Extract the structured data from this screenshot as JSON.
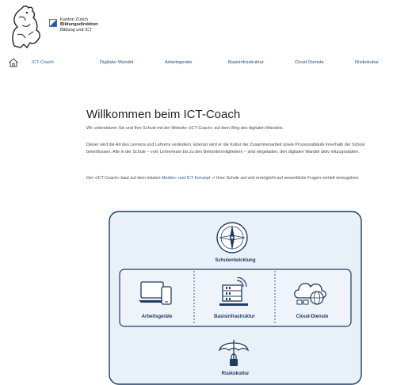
{
  "header": {
    "org_lines": [
      "Kanton Zürich",
      "Bildungsdirektion",
      "Bildung und ICT"
    ]
  },
  "nav": {
    "items": [
      {
        "label": "ICT-Coach",
        "active": true
      },
      {
        "label": "Digitaler Wandel"
      },
      {
        "label": "Arbeitsgeräte"
      },
      {
        "label": "Basisinfrastruktur"
      },
      {
        "label": "Cloud-Dienste"
      },
      {
        "label": "Risikokultur"
      }
    ]
  },
  "main": {
    "title": "Willkommen beim ICT-Coach",
    "p1": "Wir unterstützen Sie und Ihre Schule mit der Website «ICT-Coach» auf dem Weg des digitalen Wandels.",
    "p2": "Dieser wird die Art des Lernens und Lehrens verändern. Ebenso wird er die Kultur der Zusammenarbeit sowie Prozessabläufe innerhalb der Schule beeinflussen. Alle in der Schule – vom Lehrerteam bis zu den Behördenmitgliedern – sind eingeladen, den digitalen Wandel aktiv mitzugestalten.",
    "p3_before": "Der «ICT-Coach» baut auf dem lokalen ",
    "p3_link": "Medien- und ICT-Konzept ↗",
    "p3_after": " Ihrer Schule auf und ermöglicht auf wesentliche Fragen vertieft einzugehen."
  },
  "diagram": {
    "top": "Schulentwicklung",
    "middle": [
      "Arbeitsgeräte",
      "Basisinfrastruktur",
      "Cloud-Dienste"
    ],
    "bottom": "Risikokultur"
  },
  "colors": {
    "accent": "#1f5fa8",
    "diagram_fill": "#e9f1f8",
    "diagram_stroke": "#1f3a63"
  }
}
